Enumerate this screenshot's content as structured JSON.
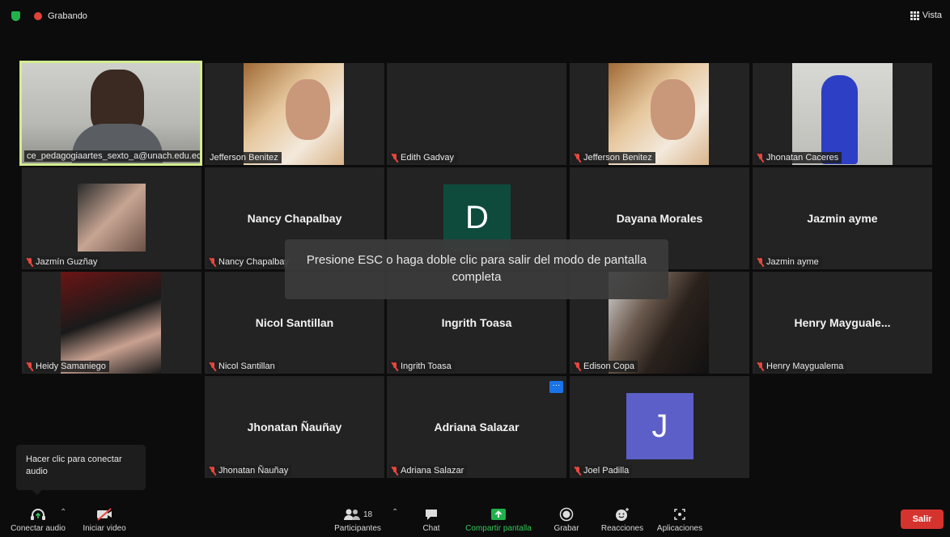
{
  "topbar": {
    "recording": "Grabando",
    "view": "Vista"
  },
  "tiles": [
    {
      "name": "ce_pedagogiaartes_sexto_a@unach.edu.ec",
      "muted": false
    },
    {
      "name": "Jefferson Benitez",
      "muted": false
    },
    {
      "name": "Edith Gadvay",
      "muted": true
    },
    {
      "name": "Jefferson Benitez",
      "muted": true
    },
    {
      "name": "Jhonatan Caceres",
      "muted": true
    },
    {
      "name": "Jazmín Guzñay",
      "muted": true
    },
    {
      "name": "Nancy Chapalbay",
      "display": "Nancy Chapalbay",
      "muted": true
    },
    {
      "name": "",
      "avatar_letter": "D",
      "muted": false
    },
    {
      "name": "",
      "display": "Dayana Morales",
      "muted": false
    },
    {
      "name": "Jazmin ayme",
      "display": "Jazmin ayme",
      "muted": true
    },
    {
      "name": "Heidy Samaniego",
      "muted": true
    },
    {
      "name": "Nicol Santillan",
      "display": "Nicol Santillan",
      "muted": true
    },
    {
      "name": "Ingrith Toasa",
      "display": "Ingrith Toasa",
      "muted": true
    },
    {
      "name": "Edison Copa",
      "muted": true
    },
    {
      "name": "Henry Maygualema",
      "display": "Henry  Mayguale...",
      "muted": true
    },
    {
      "name": "Jhonatan Ñauñay",
      "display": "Jhonatan Ñauñay",
      "muted": true
    },
    {
      "name": "Adriana Salazar",
      "display": "Adriana Salazar",
      "muted": true
    },
    {
      "name": "Joel Padilla",
      "avatar_letter": "J",
      "muted": true
    }
  ],
  "toast": {
    "text": "Presione ESC o haga doble clic para salir del modo de pantalla completa"
  },
  "tooltip": {
    "text": "Hacer clic para conectar audio"
  },
  "more_badge": "···",
  "toolbar": {
    "audio": "Conectar audio",
    "video": "Iniciar video",
    "participants": "Participantes",
    "participants_count": "18",
    "chat": "Chat",
    "share": "Compartir pantalla",
    "record": "Grabar",
    "reactions": "Reacciones",
    "apps": "Aplicaciones",
    "leave": "Salir"
  },
  "colors": {
    "active_border": "#d3ec8e",
    "avatar_d": "#0f4b3d",
    "avatar_j": "#5b5fc7",
    "share_green": "#34c759",
    "leave_red": "#d5332e"
  }
}
